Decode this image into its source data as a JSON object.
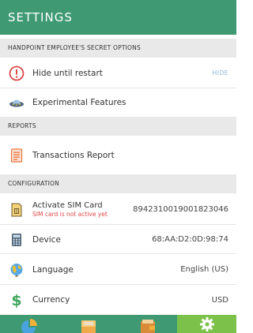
{
  "header": {
    "title": "SETTINGS"
  },
  "sections": {
    "secret": {
      "title": "HANDPOINT EMPLOYEE'S SECRET OPTIONS"
    },
    "reports": {
      "title": "REPORTS"
    },
    "configuration": {
      "title": "CONFIGURATION"
    }
  },
  "rows": {
    "hide": {
      "label": "Hide until restart",
      "value": "HIDE",
      "icon": "alert-icon"
    },
    "experimental": {
      "label": "Experimental Features",
      "icon": "ufo-icon"
    },
    "transactions": {
      "label": "Transactions Report",
      "icon": "report-icon"
    },
    "sim": {
      "label": "Activate SIM Card",
      "sublabel": "SIM card is not active yet",
      "value": "8942310019001823046",
      "icon": "sim-card-icon"
    },
    "device": {
      "label": "Device",
      "value": "68:AA:D2:0D:98:74",
      "icon": "calculator-icon"
    },
    "language": {
      "label": "Language",
      "value": "English (US)",
      "icon": "globe-icon"
    },
    "currency": {
      "label": "Currency",
      "value": "USD",
      "icon": "dollar-icon"
    }
  },
  "tabs": [
    {
      "name": "dashboard",
      "icon": "pie-chart-icon",
      "active": false
    },
    {
      "name": "transactions",
      "icon": "receipt-icon",
      "active": false
    },
    {
      "name": "wallet",
      "icon": "wallet-icon",
      "active": false
    },
    {
      "name": "settings",
      "icon": "gear-icon",
      "active": true
    }
  ],
  "colors": {
    "primary": "#3f9a73",
    "active_tab": "#7cc24a",
    "section_bg": "#e9e9e9",
    "alert": "#e04848",
    "accent_link": "#8ab7d6"
  }
}
